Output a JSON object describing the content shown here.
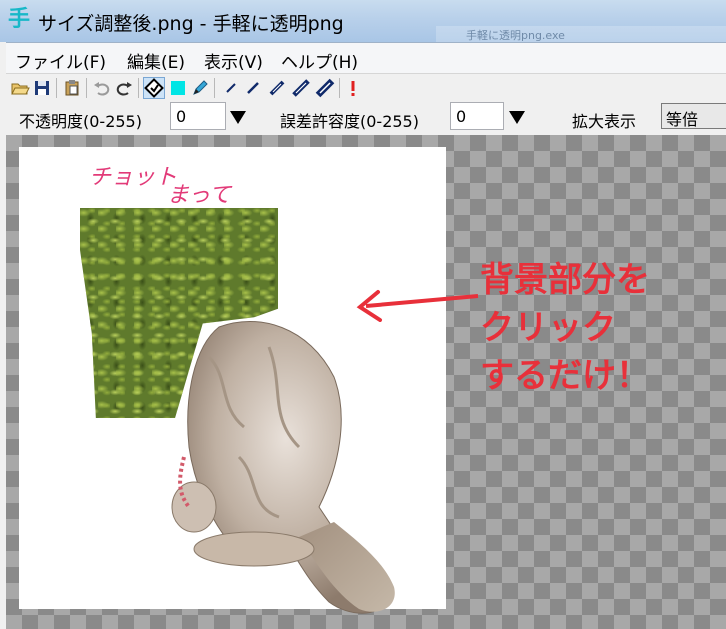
{
  "window": {
    "title": "サイズ調整後.png - 手軽に透明png",
    "icon_glyph": "手",
    "background_task_label": "手軽に透明png.exe"
  },
  "menu": {
    "items": [
      {
        "label": "ファイル(F)"
      },
      {
        "label": "編集(E)"
      },
      {
        "label": "表示(V)"
      },
      {
        "label": "ヘルプ(H)"
      }
    ]
  },
  "toolbar": {
    "icons": [
      "open-folder-icon",
      "save-icon",
      "paste-icon",
      "undo-icon",
      "redo-icon",
      "fill-transparent-icon",
      "cyan-color-icon",
      "pen-icon",
      "line-thin-1-icon",
      "line-thin-2-icon",
      "line-medium-icon",
      "line-thick-icon",
      "line-thickest-icon",
      "alert-icon"
    ],
    "active": "fill-transparent-icon"
  },
  "controls": {
    "opacity_label": "不透明度(0-255)",
    "opacity_value": "0",
    "tolerance_label": "誤差許容度(0-255)",
    "tolerance_value": "0",
    "zoom_label": "拡大表示",
    "zoom_value": "等倍"
  },
  "canvas": {
    "handwritten_line1": "チョット",
    "handwritten_line2": "まって",
    "annotation_lines": [
      "背景部分を",
      "クリック",
      "するだけ！"
    ]
  },
  "colors": {
    "accent_red": "#e8303a",
    "handwrite_pink": "#e23a78",
    "titlebar": "#b8d0ea"
  }
}
